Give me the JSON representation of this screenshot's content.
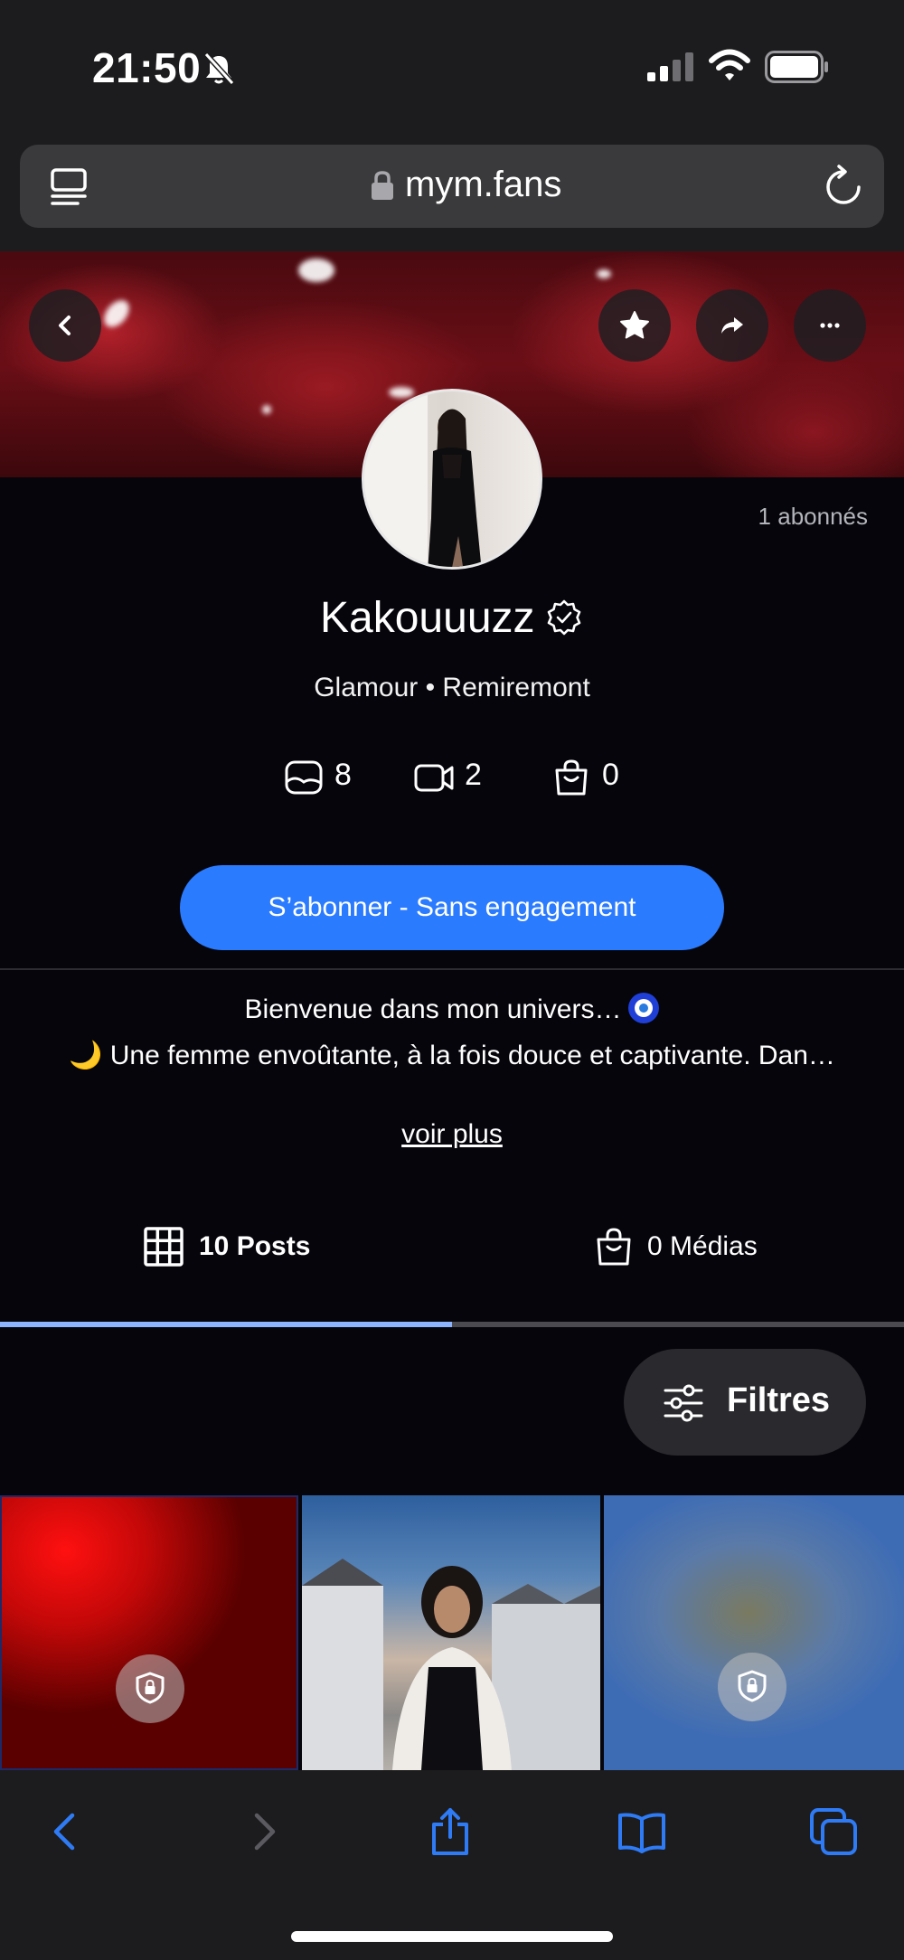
{
  "status_bar": {
    "time": "21:50"
  },
  "browser": {
    "url": "mym.fans"
  },
  "profile": {
    "subscribers": "1 abonnés",
    "name": "Kakouuuzz",
    "category": "Glamour • Remiremont",
    "stats": {
      "photos": "8",
      "videos": "2",
      "products": "0"
    },
    "subscribe_label": "S’abonner - Sans engagement",
    "bio_line1": "Bienvenue dans mon univers…",
    "bio_line2": "🌙 Une femme envoûtante, à la fois douce et captivante. Dan…",
    "see_more": "voir plus"
  },
  "tabs": {
    "posts": "10 Posts",
    "medias": "0 Médias",
    "active": "posts"
  },
  "filters_label": "Filtres",
  "colors": {
    "accent": "#2b7bff",
    "page_bg": "#05050b",
    "tab_active": "#8cb4ff"
  }
}
